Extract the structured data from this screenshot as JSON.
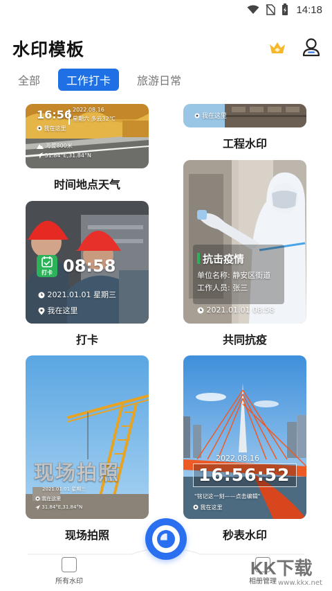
{
  "status_bar": {
    "time": "14:18"
  },
  "header": {
    "title": "水印模板"
  },
  "tabs": [
    {
      "label": "全部"
    },
    {
      "label": "工作打卡",
      "active": true
    },
    {
      "label": "旅游日常"
    }
  ],
  "cards": {
    "weather": {
      "label": "时间地点天气",
      "time": "16:56",
      "date": "2022.08.16",
      "weekday_weather": "星期六 多云32℃",
      "location": "我在这里",
      "altitude": "海拔800米",
      "coords": "31.84°E,31.84°N"
    },
    "engineering": {
      "label": "工程水印",
      "location": "我在这里"
    },
    "checkin": {
      "label": "打卡",
      "badge": "打卡",
      "time": "08:58",
      "date": "2021.01.01 星期三",
      "location": "我在这里"
    },
    "epidemic": {
      "label": "共同抗疫",
      "heading": "抗击疫情",
      "unit": "单位名称: 静安区街道",
      "staff": "工作人员: 张三",
      "datetime": "2021.01.01 08:58"
    },
    "site_photo": {
      "label": "现场拍照",
      "title": "现场拍照",
      "date": "2021.01.01 星期三",
      "location": "我在这里",
      "coords": "31.84°E,31.84°N"
    },
    "stopwatch": {
      "label": "秒表水印",
      "date": "2022.08.16",
      "time": "16:56:52",
      "caption": "\"铭记这一刻——点击编辑\"",
      "location": "我在这里"
    }
  },
  "bottom_nav": {
    "left_label": "所有水印",
    "right_label": "相册管理"
  },
  "site_mark": {
    "logo": "KK下载",
    "url": "www.kkx.net"
  },
  "colors": {
    "accent": "#1f6fe5",
    "crown": "#f6b72c"
  }
}
